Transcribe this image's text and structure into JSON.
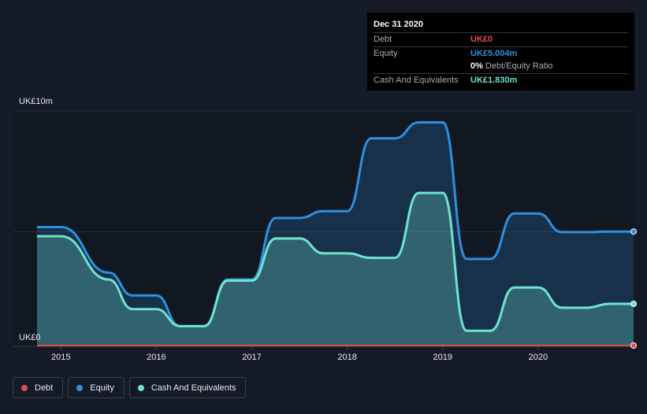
{
  "chart_data": {
    "type": "area",
    "x": [
      2014.75,
      2015.0,
      2015.5,
      2015.75,
      2016.0,
      2016.25,
      2016.5,
      2016.75,
      2017.0,
      2017.25,
      2017.5,
      2017.75,
      2018.0,
      2018.25,
      2018.5,
      2018.75,
      2019.0,
      2019.25,
      2019.5,
      2019.75,
      2020.0,
      2020.25,
      2020.5,
      2020.75,
      2021.0
    ],
    "series": [
      {
        "name": "Debt",
        "color": "#e34b52",
        "values": [
          0,
          0,
          0,
          0,
          0,
          0,
          0,
          0,
          0,
          0,
          0,
          0,
          0,
          0,
          0,
          0,
          0,
          0,
          0,
          0,
          0,
          0,
          0,
          0,
          0
        ]
      },
      {
        "name": "Equity",
        "color": "#2f8fe0",
        "values": [
          5.2,
          5.2,
          3.2,
          2.2,
          2.2,
          0.85,
          0.85,
          2.9,
          2.9,
          5.6,
          5.6,
          5.9,
          5.9,
          9.1,
          9.1,
          9.8,
          9.8,
          3.8,
          3.8,
          5.8,
          5.8,
          4.98,
          4.98,
          5.004,
          5.004
        ]
      },
      {
        "name": "Cash And Equivalents",
        "color": "#6fe3d0",
        "values": [
          4.8,
          4.8,
          2.9,
          1.6,
          1.6,
          0.85,
          0.85,
          2.85,
          2.85,
          4.7,
          4.7,
          4.05,
          4.05,
          3.85,
          3.85,
          6.7,
          6.7,
          0.65,
          0.65,
          2.55,
          2.55,
          1.66,
          1.66,
          1.83,
          1.83
        ]
      }
    ],
    "ylim": [
      0,
      10.3
    ],
    "xlim": [
      2014.75,
      2021.0
    ],
    "ytick_labels": [
      "UK£0",
      "UK£10m"
    ],
    "xtick_labels": [
      "2015",
      "2016",
      "2017",
      "2018",
      "2019",
      "2020"
    ],
    "xtick_values": [
      2015,
      2016,
      2017,
      2018,
      2019,
      2020
    ],
    "grid": true,
    "legend_position": "bottom-left"
  },
  "tooltip": {
    "date": "Dec 31 2020",
    "debt_label": "Debt",
    "debt_value": "UK£0",
    "equity_label": "Equity",
    "equity_value": "UK£5.004m",
    "ratio_pct": "0%",
    "ratio_label": "Debt/Equity Ratio",
    "cash_label": "Cash And Equivalents",
    "cash_value": "UK£1.830m"
  },
  "legend": {
    "debt": "Debt",
    "equity": "Equity",
    "cash": "Cash And Equivalents"
  },
  "colors": {
    "debt": "#e34b52",
    "equity": "#2f8fe0",
    "cash": "#6fe3d0",
    "background": "#151b26"
  }
}
